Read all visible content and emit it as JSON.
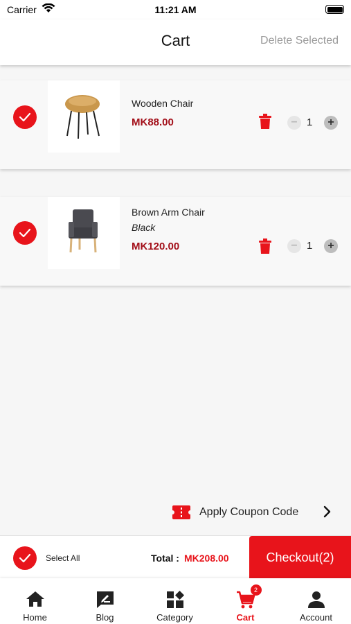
{
  "status_bar": {
    "carrier": "Carrier",
    "time": "11:21 AM"
  },
  "header": {
    "title": "Cart",
    "delete_selected": "Delete Selected"
  },
  "items": [
    {
      "name": "Wooden Chair",
      "variant": "",
      "price": "MK88.00",
      "quantity": "1",
      "selected": true,
      "image": "tan-bucket-chair"
    },
    {
      "name": "Brown Arm Chair",
      "variant": "Black",
      "price": "MK120.00",
      "quantity": "1",
      "selected": true,
      "image": "grey-tufted-armchair"
    }
  ],
  "coupon": {
    "label": "Apply Coupon Code"
  },
  "checkout_bar": {
    "select_all": "Select All",
    "total_label": "Total :",
    "total_value": "MK208.00",
    "checkout_label": "Checkout(2)"
  },
  "tabs": [
    {
      "label": "Home",
      "icon": "home-icon",
      "active": false
    },
    {
      "label": "Blog",
      "icon": "blog-icon",
      "active": false
    },
    {
      "label": "Category",
      "icon": "category-icon",
      "active": false
    },
    {
      "label": "Cart",
      "icon": "cart-icon",
      "active": true,
      "badge": "2"
    },
    {
      "label": "Account",
      "icon": "account-icon",
      "active": false
    }
  ],
  "colors": {
    "accent": "#e8141b",
    "price": "#a3101a",
    "muted": "#9a9a9a"
  }
}
